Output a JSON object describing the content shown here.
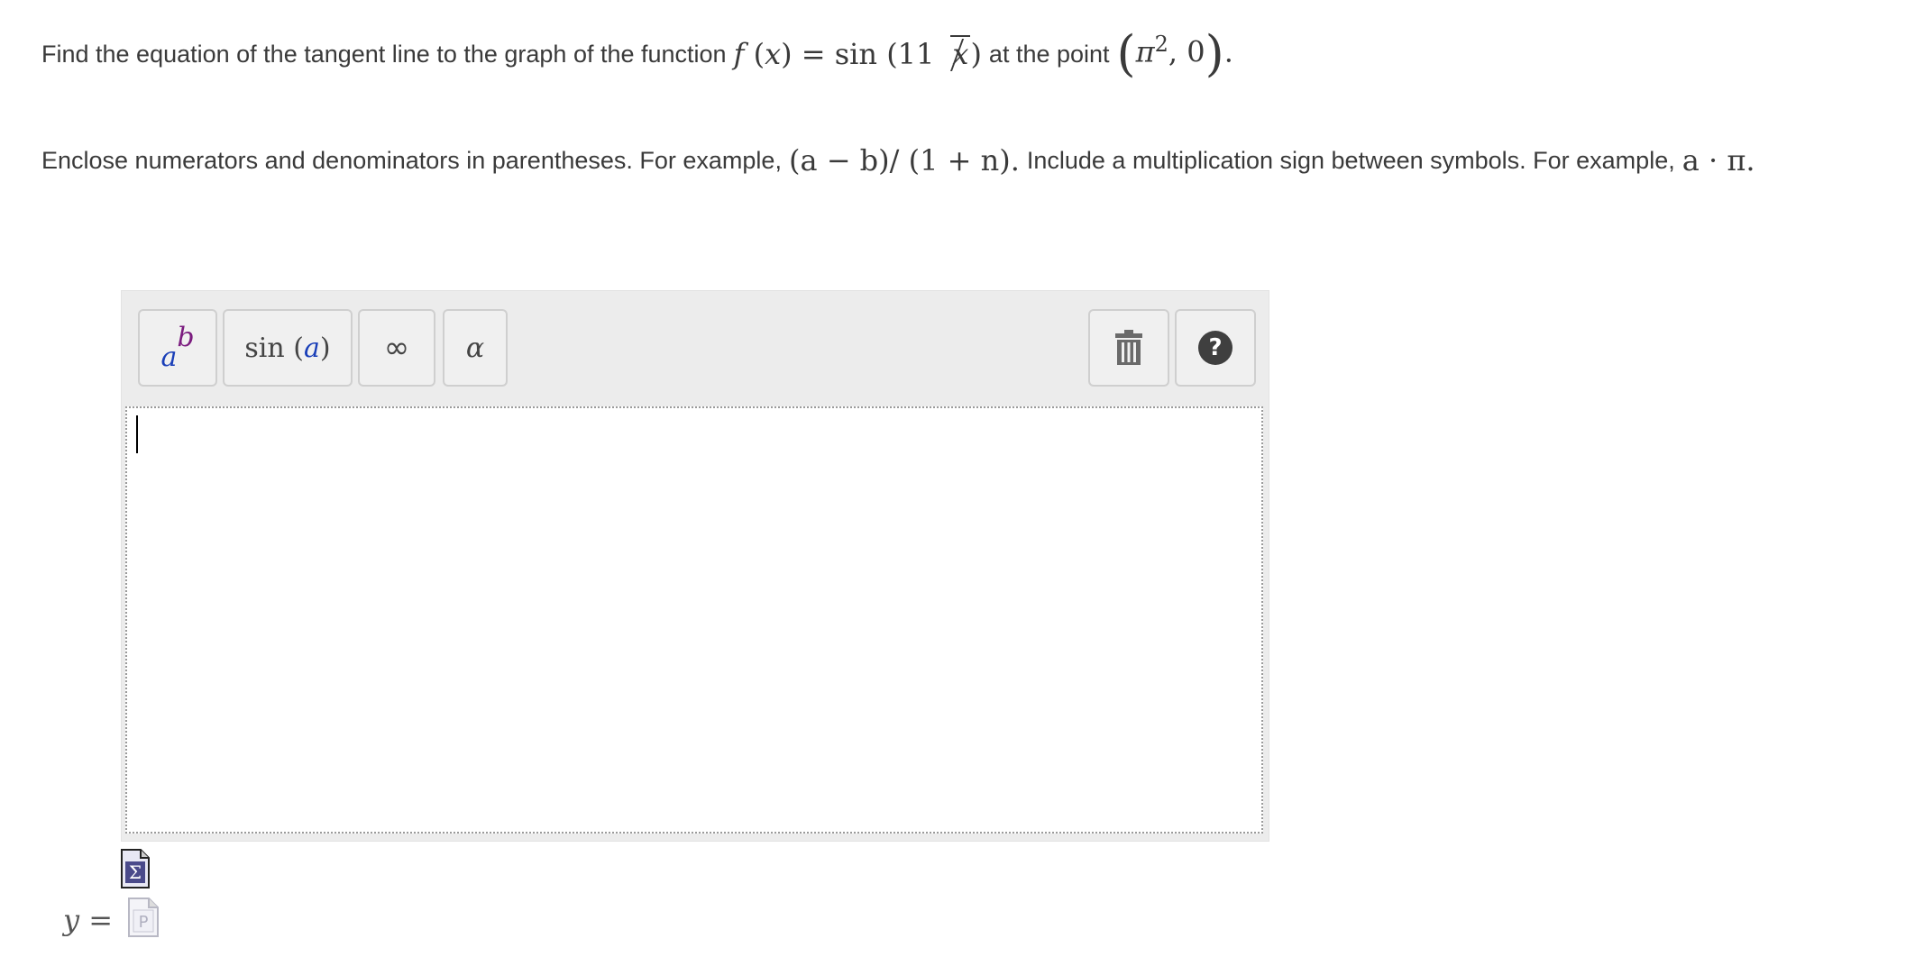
{
  "question": {
    "prefix": "Find the equation of the tangent line to the graph of the function",
    "fn_name": "f",
    "fn_var": "x",
    "fn_op": "sin",
    "fn_coef": "11",
    "fn_inner_var": "x",
    "mid_text": "at the point",
    "point_base": "π",
    "point_exp": "2",
    "point_y": "0"
  },
  "instructions": {
    "part1": "Enclose numerators and denominators in parentheses. For example,",
    "example1": "(a − b)/ (1 + n).",
    "part2": "Include a multiplication sign between symbols. For example,",
    "example2": "a · π."
  },
  "toolbar": {
    "power_base": "a",
    "power_exp": "b",
    "trig_fn": "sin",
    "trig_var": "a",
    "infinity": "∞",
    "greek": "α",
    "trash_icon": "trash-icon",
    "help_label": "?"
  },
  "answer": {
    "label_var": "y",
    "label_eq": "=",
    "value": ""
  }
}
